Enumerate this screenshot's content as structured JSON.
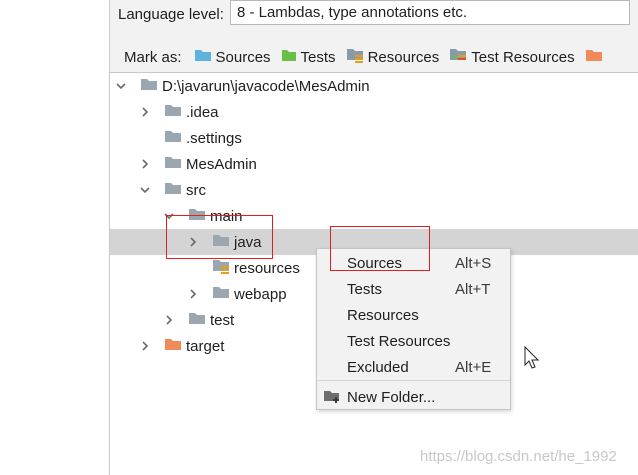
{
  "top": {
    "language_label": "Language level:",
    "language_value": "8 - Lambdas, type annotations etc.",
    "mark_as_label": "Mark as:",
    "mark_buttons": [
      {
        "label": "Sources",
        "icon": "sources-folder-icon",
        "color": "#5eb2e0"
      },
      {
        "label": "Tests",
        "icon": "tests-folder-icon",
        "color": "#6abf4b"
      },
      {
        "label": "Resources",
        "icon": "resources-folder-icon",
        "color": "#8a9aa6"
      },
      {
        "label": "Test Resources",
        "icon": "test-resources-folder-icon",
        "color": "#8a9aa6"
      },
      {
        "label": "",
        "icon": "excluded-folder-icon",
        "color": "#f08a5b"
      }
    ]
  },
  "tree": {
    "items": [
      {
        "label": "D:\\javarun\\javacode\\MesAdmin",
        "expanded": true,
        "has_arrow": true,
        "folder_color": "#9aa7b0"
      },
      {
        "label": ".idea",
        "expanded": false,
        "has_arrow": true,
        "folder_color": "#9aa7b0"
      },
      {
        "label": ".settings",
        "expanded": false,
        "has_arrow": false,
        "folder_color": "#9aa7b0"
      },
      {
        "label": "MesAdmin",
        "expanded": false,
        "has_arrow": true,
        "folder_color": "#9aa7b0"
      },
      {
        "label": "src",
        "expanded": true,
        "has_arrow": true,
        "folder_color": "#9aa7b0"
      },
      {
        "label": "main",
        "expanded": true,
        "has_arrow": true,
        "folder_color": "#9aa7b0"
      },
      {
        "label": "java",
        "expanded": false,
        "has_arrow": true,
        "folder_color": "#9aa7b0",
        "selected": true
      },
      {
        "label": "resources",
        "expanded": false,
        "has_arrow": false,
        "folder_color": "#9aa7b0",
        "resources": true
      },
      {
        "label": "webapp",
        "expanded": false,
        "has_arrow": true,
        "folder_color": "#9aa7b0"
      },
      {
        "label": "test",
        "expanded": false,
        "has_arrow": true,
        "folder_color": "#9aa7b0"
      },
      {
        "label": "target",
        "expanded": false,
        "has_arrow": true,
        "folder_color": "#f08a5b"
      }
    ]
  },
  "menu": {
    "items": [
      {
        "label": "Sources",
        "shortcut": "Alt+S"
      },
      {
        "label": "Tests",
        "shortcut": "Alt+T"
      },
      {
        "label": "Resources",
        "shortcut": ""
      },
      {
        "label": "Test Resources",
        "shortcut": ""
      },
      {
        "label": "Excluded",
        "shortcut": "Alt+E"
      },
      {
        "label": "New Folder...",
        "shortcut": "",
        "icon": "new-folder-icon"
      }
    ]
  },
  "watermark": "https://blog.csdn.net/he_1992",
  "colors": {
    "highlight_box": "#e02020",
    "selection": "#d4d4d4",
    "panel_bg": "#f2f2f2"
  }
}
